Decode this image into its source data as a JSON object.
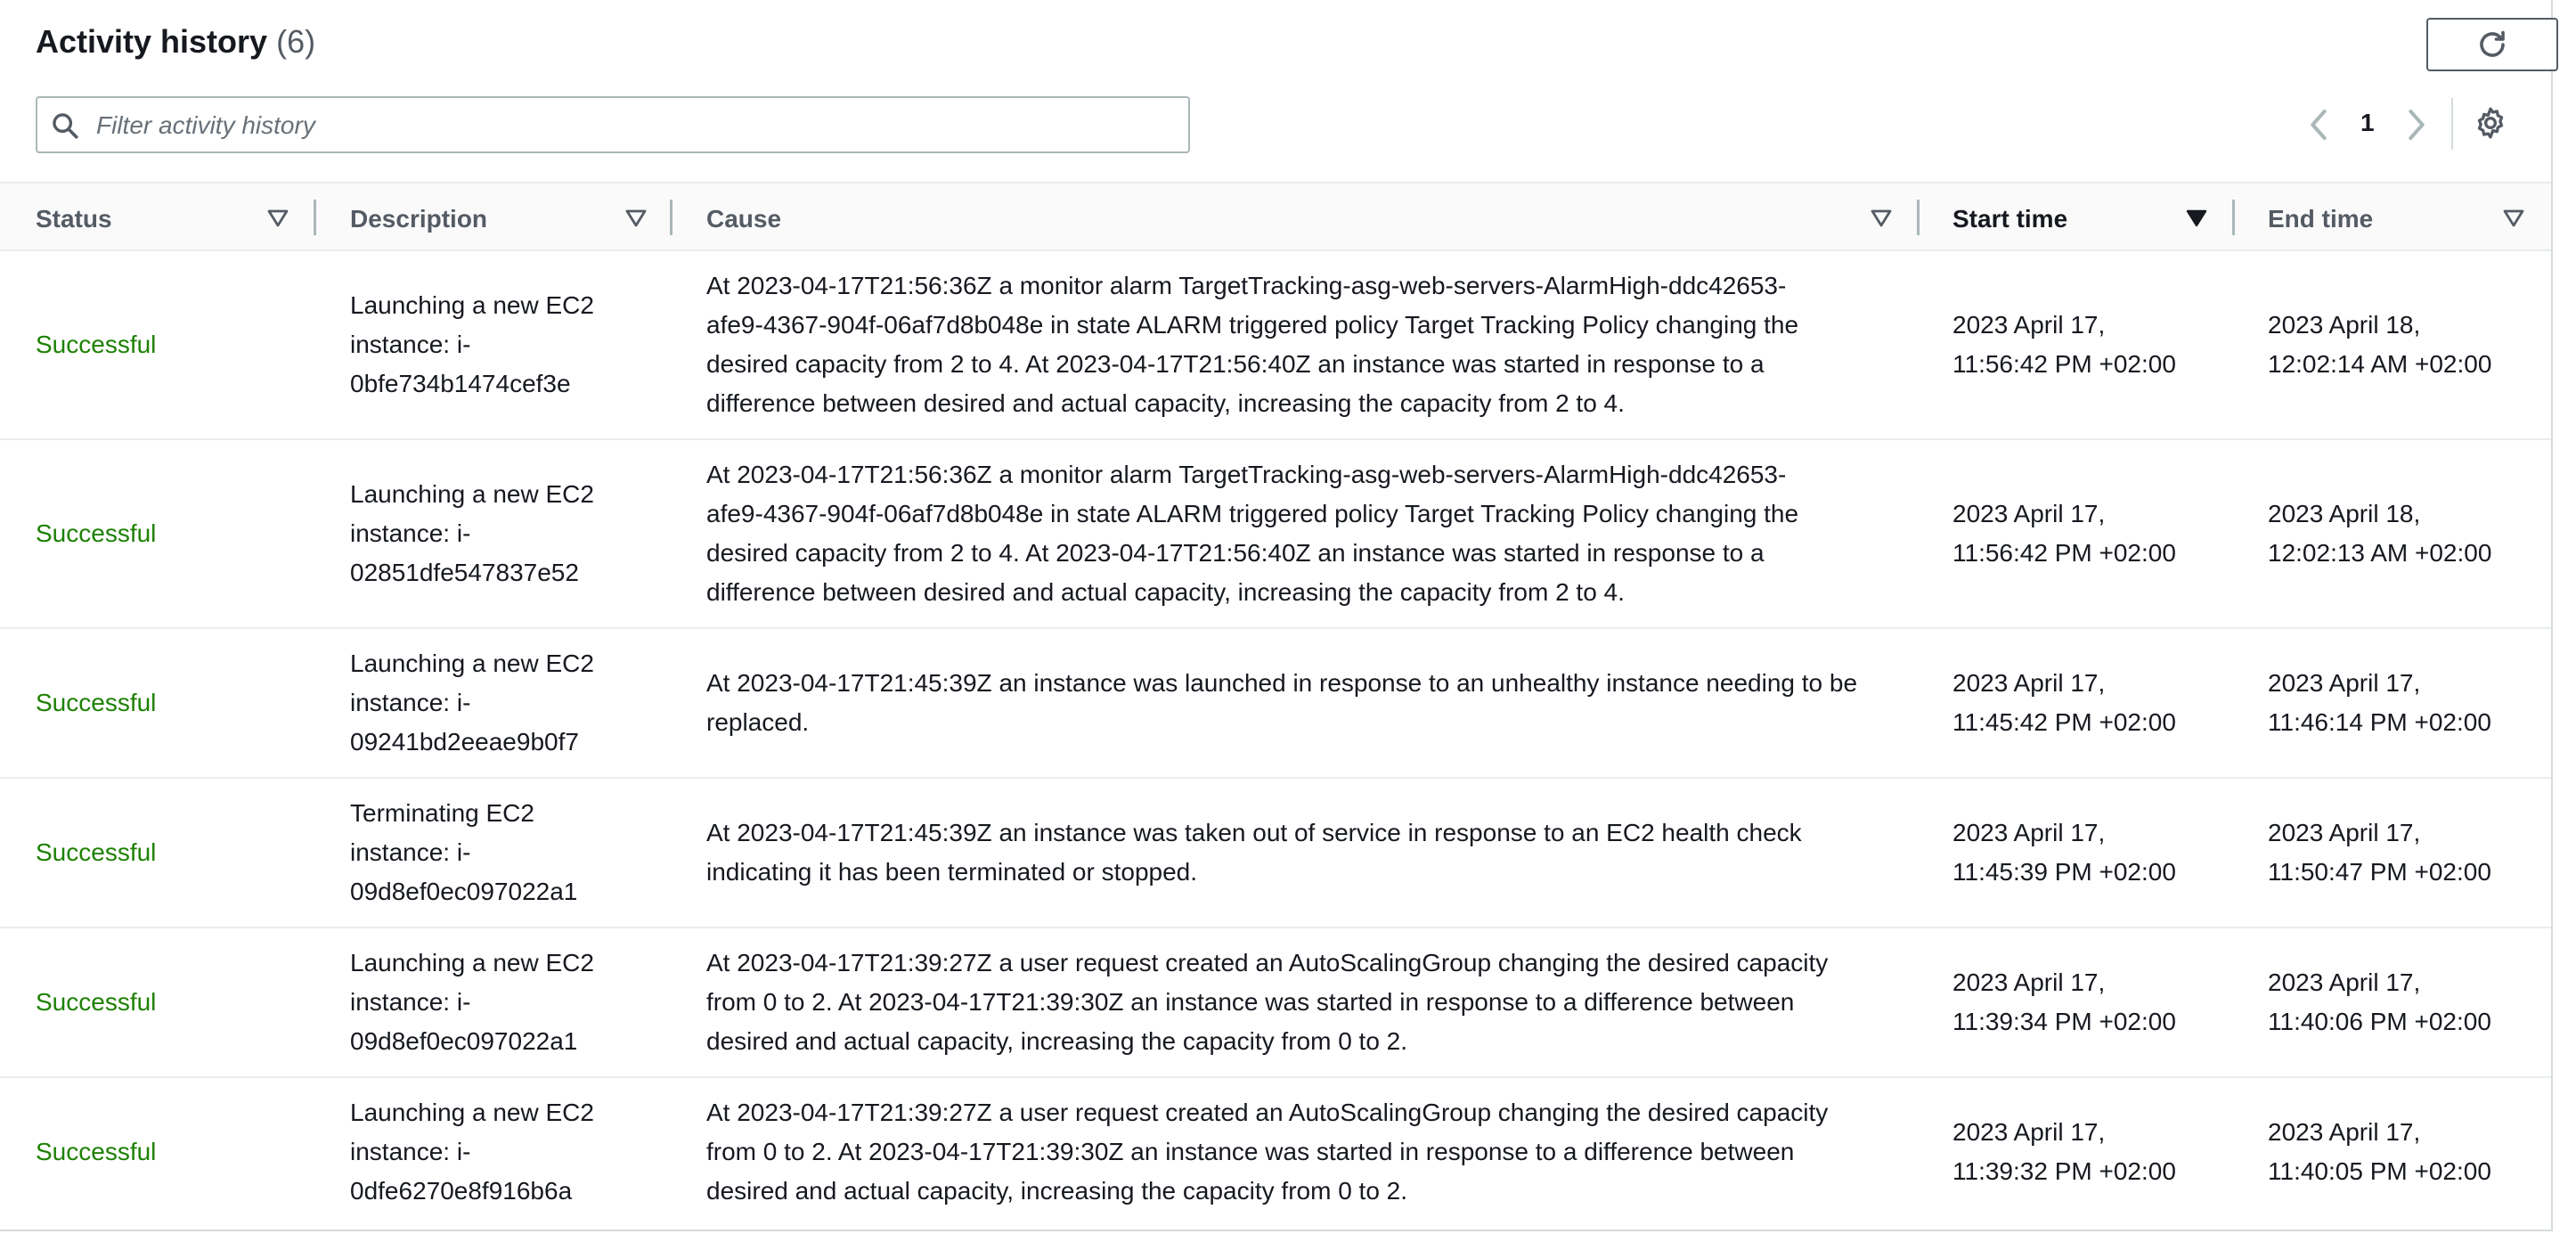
{
  "header": {
    "title": "Activity history",
    "count": "(6)"
  },
  "search": {
    "placeholder": "Filter activity history",
    "value": ""
  },
  "pagination": {
    "current_page": "1"
  },
  "table": {
    "columns": [
      "Status",
      "Description",
      "Cause",
      "Start time",
      "End time"
    ],
    "sorted_column": "Start time",
    "rows": [
      {
        "status": "Successful",
        "description": [
          "Launching a new EC2",
          "instance: i-",
          "0bfe734b1474cef3e"
        ],
        "cause": [
          "At 2023-04-17T21:56:36Z a monitor alarm TargetTracking-asg-web-servers-AlarmHigh-ddc42653-",
          "afe9-4367-904f-06af7d8b048e in state ALARM triggered policy Target Tracking Policy changing the",
          "desired capacity from 2 to 4. At 2023-04-17T21:56:40Z an instance was started in response to a",
          "difference between desired and actual capacity, increasing the capacity from 2 to 4."
        ],
        "start": [
          "2023 April 17,",
          "11:56:42 PM +02:00"
        ],
        "end": [
          "2023 April 18,",
          "12:02:14 AM +02:00"
        ]
      },
      {
        "status": "Successful",
        "description": [
          "Launching a new EC2",
          "instance: i-",
          "02851dfe547837e52"
        ],
        "cause": [
          "At 2023-04-17T21:56:36Z a monitor alarm TargetTracking-asg-web-servers-AlarmHigh-ddc42653-",
          "afe9-4367-904f-06af7d8b048e in state ALARM triggered policy Target Tracking Policy changing the",
          "desired capacity from 2 to 4. At 2023-04-17T21:56:40Z an instance was started in response to a",
          "difference between desired and actual capacity, increasing the capacity from 2 to 4."
        ],
        "start": [
          "2023 April 17,",
          "11:56:42 PM +02:00"
        ],
        "end": [
          "2023 April 18,",
          "12:02:13 AM +02:00"
        ]
      },
      {
        "status": "Successful",
        "description": [
          "Launching a new EC2",
          "instance: i-",
          "09241bd2eeae9b0f7"
        ],
        "cause": [
          "At 2023-04-17T21:45:39Z an instance was launched in response to an unhealthy instance needing to be",
          "replaced."
        ],
        "start": [
          "2023 April 17,",
          "11:45:42 PM +02:00"
        ],
        "end": [
          "2023 April 17,",
          "11:46:14 PM +02:00"
        ]
      },
      {
        "status": "Successful",
        "description": [
          "Terminating EC2",
          "instance: i-",
          "09d8ef0ec097022a1"
        ],
        "cause": [
          "At 2023-04-17T21:45:39Z an instance was taken out of service in response to an EC2 health check",
          "indicating it has been terminated or stopped."
        ],
        "start": [
          "2023 April 17,",
          "11:45:39 PM +02:00"
        ],
        "end": [
          "2023 April 17,",
          "11:50:47 PM +02:00"
        ]
      },
      {
        "status": "Successful",
        "description": [
          "Launching a new EC2",
          "instance: i-",
          "09d8ef0ec097022a1"
        ],
        "cause": [
          "At 2023-04-17T21:39:27Z a user request created an AutoScalingGroup changing the desired capacity",
          "from 0 to 2. At 2023-04-17T21:39:30Z an instance was started in response to a difference between",
          "desired and actual capacity, increasing the capacity from 0 to 2."
        ],
        "start": [
          "2023 April 17,",
          "11:39:34 PM +02:00"
        ],
        "end": [
          "2023 April 17,",
          "11:40:06 PM +02:00"
        ]
      },
      {
        "status": "Successful",
        "description": [
          "Launching a new EC2",
          "instance: i-",
          "0dfe6270e8f916b6a"
        ],
        "cause": [
          "At 2023-04-17T21:39:27Z a user request created an AutoScalingGroup changing the desired capacity",
          "from 0 to 2. At 2023-04-17T21:39:30Z an instance was started in response to a difference between",
          "desired and actual capacity, increasing the capacity from 0 to 2."
        ],
        "start": [
          "2023 April 17,",
          "11:39:32 PM +02:00"
        ],
        "end": [
          "2023 April 17,",
          "11:40:05 PM +02:00"
        ]
      }
    ]
  },
  "icons": {
    "refresh": "refresh-icon",
    "search": "search-icon",
    "prev": "chevron-left-icon",
    "next": "chevron-right-icon",
    "settings": "gear-icon",
    "sort": "caret-down-icon"
  },
  "colors": {
    "success": "#1d8102",
    "text": "#16191f",
    "muted": "#545b64",
    "border": "#aab7b8"
  }
}
